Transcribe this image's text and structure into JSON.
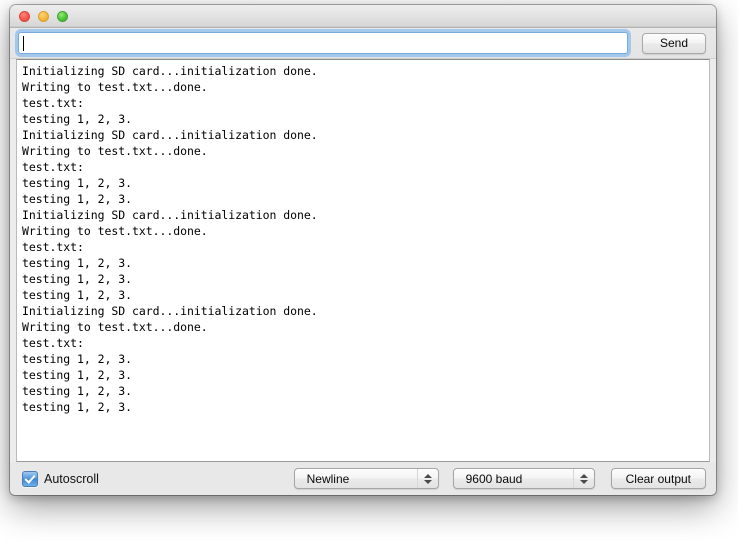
{
  "window": {
    "traffic_lights": [
      {
        "name": "close",
        "color": "#fb5b52"
      },
      {
        "name": "minimize",
        "color": "#f9bb42"
      },
      {
        "name": "zoom",
        "color": "#56c940"
      }
    ]
  },
  "send_row": {
    "input_value": "",
    "input_placeholder": "",
    "send_label": "Send"
  },
  "output": {
    "lines": [
      "Initializing SD card...initialization done.",
      "Writing to test.txt...done.",
      "test.txt:",
      "testing 1, 2, 3.",
      "Initializing SD card...initialization done.",
      "Writing to test.txt...done.",
      "test.txt:",
      "testing 1, 2, 3.",
      "testing 1, 2, 3.",
      "Initializing SD card...initialization done.",
      "Writing to test.txt...done.",
      "test.txt:",
      "testing 1, 2, 3.",
      "testing 1, 2, 3.",
      "testing 1, 2, 3.",
      "Initializing SD card...initialization done.",
      "Writing to test.txt...done.",
      "test.txt:",
      "testing 1, 2, 3.",
      "testing 1, 2, 3.",
      "testing 1, 2, 3.",
      "testing 1, 2, 3."
    ],
    "text": "Initializing SD card...initialization done.\nWriting to test.txt...done.\ntest.txt:\ntesting 1, 2, 3.\nInitializing SD card...initialization done.\nWriting to test.txt...done.\ntest.txt:\ntesting 1, 2, 3.\ntesting 1, 2, 3.\nInitializing SD card...initialization done.\nWriting to test.txt...done.\ntest.txt:\ntesting 1, 2, 3.\ntesting 1, 2, 3.\ntesting 1, 2, 3.\nInitializing SD card...initialization done.\nWriting to test.txt...done.\ntest.txt:\ntesting 1, 2, 3.\ntesting 1, 2, 3.\ntesting 1, 2, 3.\ntesting 1, 2, 3."
  },
  "bottom_bar": {
    "autoscroll_label": "Autoscroll",
    "autoscroll_checked": true,
    "line_ending_value": "Newline",
    "baud_value": "9600 baud",
    "clear_label": "Clear output"
  }
}
